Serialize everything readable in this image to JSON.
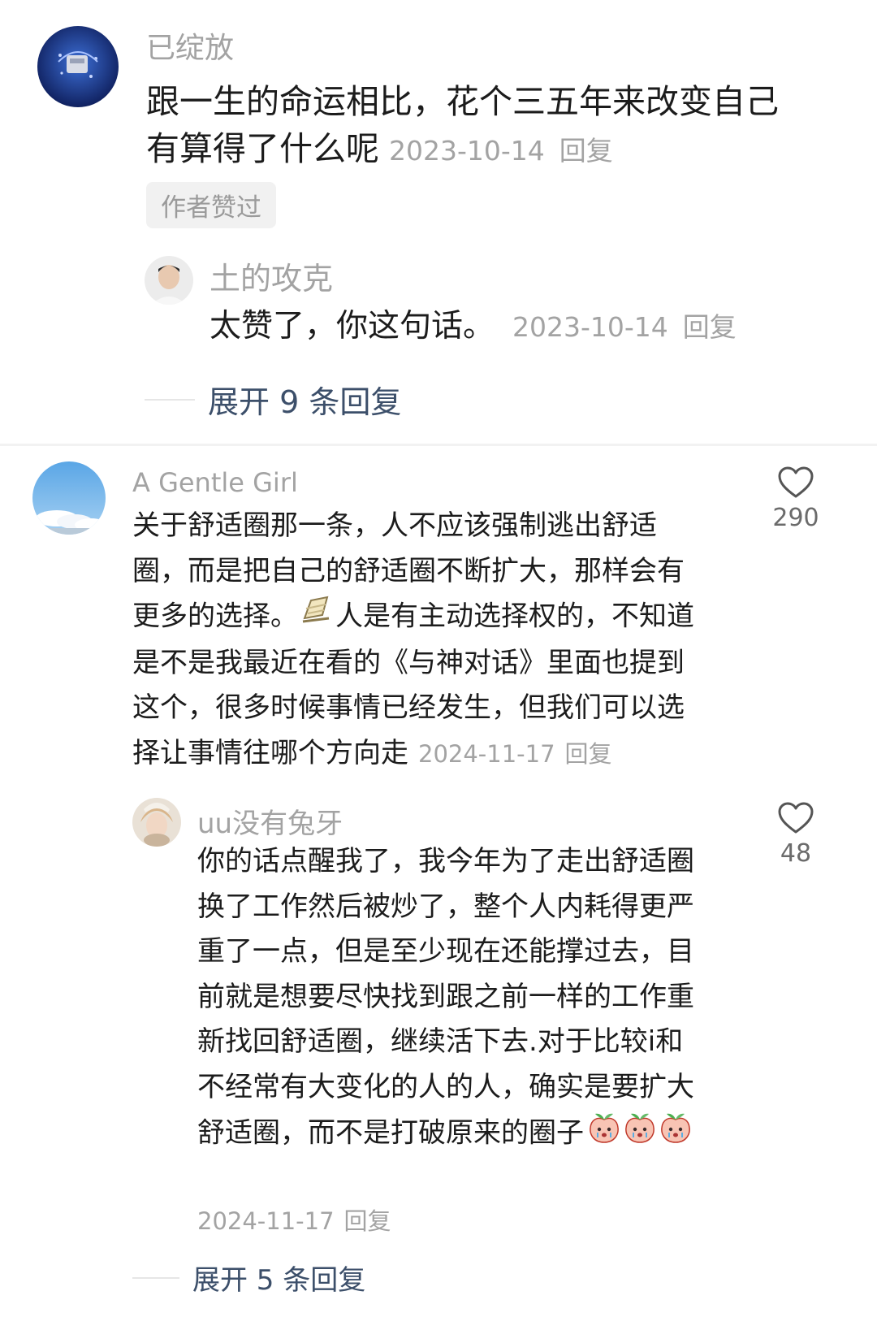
{
  "comments": [
    {
      "username": "已绽放",
      "content_lines": [
        "跟一生的命运相比，花个三五年来改变自己",
        "有算得了什么呢"
      ],
      "date": "2023-10-14",
      "reply_label": "回复",
      "badge": "作者赞过",
      "replies": [
        {
          "username": "土的攻克",
          "content": "太赞了，你这句话。",
          "date": "2023-10-14",
          "reply_label": "回复"
        }
      ],
      "expand_label": "展开 9 条回复"
    },
    {
      "username": "A Gentle Girl",
      "like_count": "290",
      "content_lines": [
        "关于舒适圈那一条，人不应该强制逃出舒适",
        "圈，而是把自己的舒适圈不断扩大，那样会有",
        "更多的选择。",
        "人是有主动选择权的，不知道",
        "是不是我最近在看的《与神对话》里面也提到",
        "这个，很多时候事情已经发生，但我们可以选",
        "择让事情往哪个方向走"
      ],
      "date": "2024-11-17",
      "reply_label": "回复",
      "replies": [
        {
          "username": "uu没有兔牙",
          "like_count": "48",
          "content_lines": [
            "你的话点醒我了，我今年为了走出舒适圈",
            "换了工作然后被炒了，整个人内耗得更严",
            "重了一点，但是至少现在还能撑过去，目",
            "前就是想要尽快找到跟之前一样的工作重",
            "新找回舒适圈，继续活下去.对于比较i和",
            "不经常有大变化的人的人，确实是要扩大",
            "舒适圈，而不是打破原来的圈子"
          ],
          "date": "2024-11-17",
          "reply_label": "回复"
        }
      ],
      "expand_label": "展开 5 条回复"
    }
  ],
  "icons": {
    "like": "heart-outline-icon",
    "inline_emoji": "lounge-chair-emoji",
    "peach_emoji": "crying-peach-emoji"
  },
  "colors": {
    "username": "#a3a3a3",
    "text": "#1c1c1c",
    "expand_link": "#3c4f6a",
    "badge_bg": "#f1f1f1"
  }
}
